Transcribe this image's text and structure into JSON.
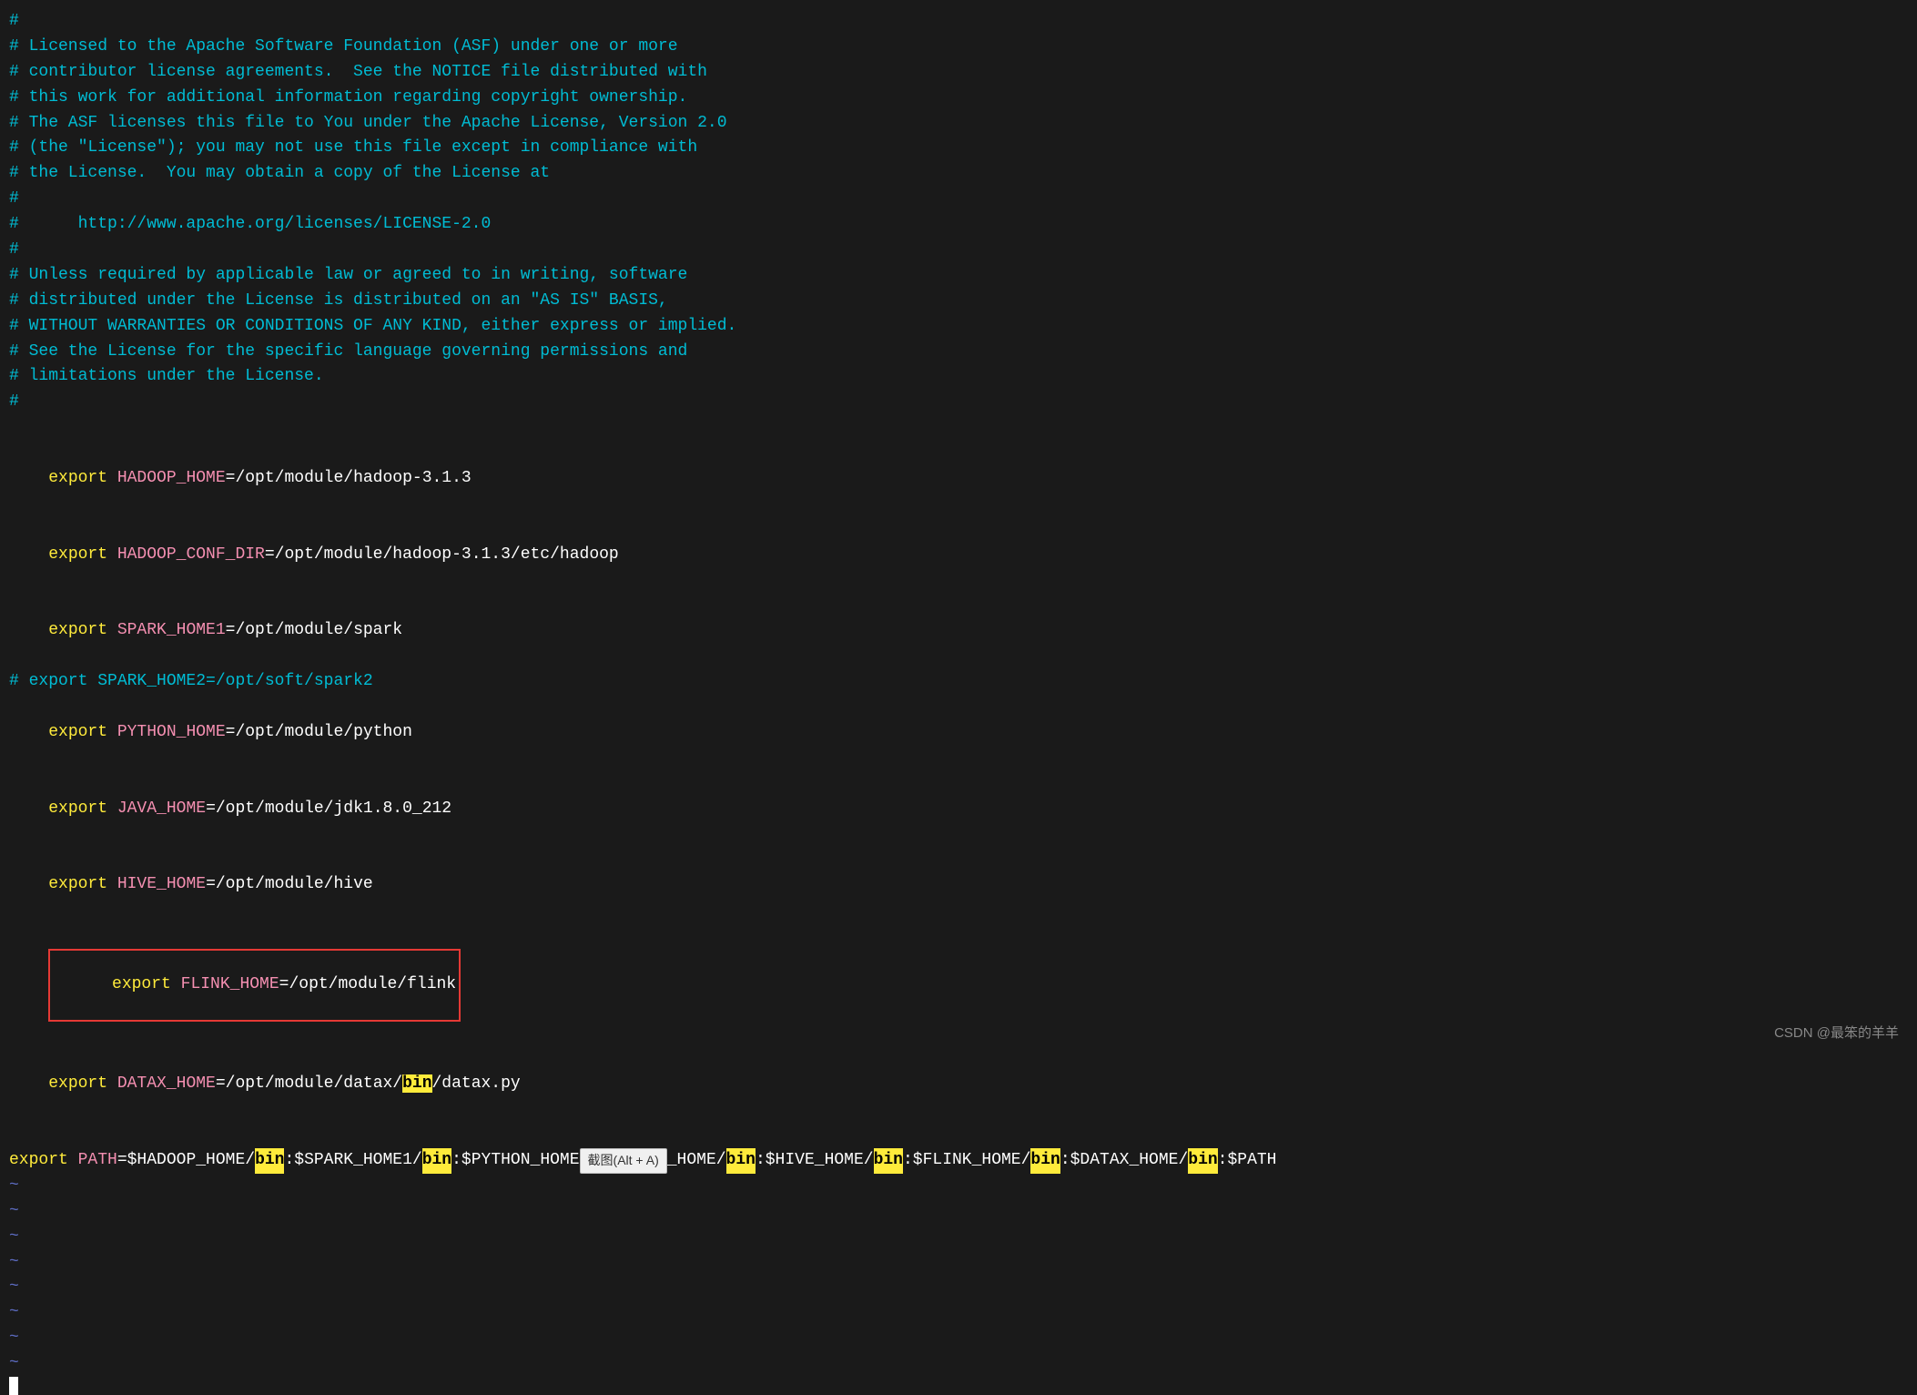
{
  "editor": {
    "background": "#1a1a1a",
    "lines": [
      {
        "type": "comment",
        "text": "#"
      },
      {
        "type": "comment",
        "text": "# Licensed to the Apache Software Foundation (ASF) under one or more"
      },
      {
        "type": "comment",
        "text": "# contributor license agreements.  See the NOTICE file distributed with"
      },
      {
        "type": "comment",
        "text": "# this work for additional information regarding copyright ownership."
      },
      {
        "type": "comment",
        "text": "# The ASF licenses this file to You under the Apache License, Version 2.0"
      },
      {
        "type": "comment",
        "text": "# (the \"License\"); you may not use this file except in compliance with"
      },
      {
        "type": "comment",
        "text": "# the License.  You may obtain a copy of the License at"
      },
      {
        "type": "comment",
        "text": "#"
      },
      {
        "type": "comment",
        "text": "#      http://www.apache.org/licenses/LICENSE-2.0"
      },
      {
        "type": "comment",
        "text": "#"
      },
      {
        "type": "comment",
        "text": "# Unless required by applicable law or agreed to in writing, software"
      },
      {
        "type": "comment",
        "text": "# distributed under the License is distributed on an \"AS IS\" BASIS,"
      },
      {
        "type": "comment",
        "text": "# WITHOUT WARRANTIES OR CONDITIONS OF ANY KIND, either express or implied."
      },
      {
        "type": "comment",
        "text": "# See the License for the specific language governing permissions and"
      },
      {
        "type": "comment",
        "text": "# limitations under the License."
      },
      {
        "type": "comment",
        "text": "#"
      },
      {
        "type": "empty",
        "text": ""
      },
      {
        "type": "export",
        "keyword": "export",
        "varname": "HADOOP_HOME",
        "value": "=/opt/module/hadoop-3.1.3"
      },
      {
        "type": "export",
        "keyword": "export",
        "varname": "HADOOP_CONF_DIR",
        "value": "=/opt/module/hadoop-3.1.3/etc/hadoop"
      },
      {
        "type": "export",
        "keyword": "export",
        "varname": "SPARK_HOME1",
        "value": "=/opt/module/spark"
      },
      {
        "type": "comment",
        "text": "# export SPARK_HOME2=/opt/soft/spark2"
      },
      {
        "type": "export",
        "keyword": "export",
        "varname": "PYTHON_HOME",
        "value": "=/opt/module/python"
      },
      {
        "type": "export",
        "keyword": "export",
        "varname": "JAVA_HOME",
        "value": "=/opt/module/jdk1.8.0_212"
      },
      {
        "type": "export",
        "keyword": "export",
        "varname": "HIVE_HOME",
        "value": "=/opt/module/hive"
      },
      {
        "type": "export_highlighted",
        "keyword": "export",
        "varname": "FLINK_HOME",
        "value": "=/opt/module/flink"
      },
      {
        "type": "export_bin",
        "keyword": "export",
        "varname": "DATAX_HOME",
        "value": "=/opt/module/datax/",
        "bin": "bin",
        "rest": "/datax.py"
      },
      {
        "type": "empty",
        "text": ""
      },
      {
        "type": "path_line"
      },
      {
        "type": "tilde"
      },
      {
        "type": "tilde"
      },
      {
        "type": "tilde"
      },
      {
        "type": "tilde"
      },
      {
        "type": "tilde"
      },
      {
        "type": "tilde"
      },
      {
        "type": "tilde"
      },
      {
        "type": "tilde"
      },
      {
        "type": "cursor_line"
      }
    ],
    "path": {
      "keyword": "export",
      "varname": "PATH",
      "segments": [
        {
          "text": "=$HADOOP_HOME/"
        },
        {
          "text": "bin",
          "highlight": true
        },
        {
          "text": ":$SPARK_HOME1/"
        },
        {
          "text": "bin",
          "highlight": true
        },
        {
          "text": ":$PYTHON_HOME"
        },
        {
          "text": "截图(Alt + A)",
          "tooltip": true
        },
        {
          "text": "_HOME/"
        },
        {
          "text": "bin",
          "highlight": true
        },
        {
          "text": ":$HIVE_HOME/"
        },
        {
          "text": "bin",
          "highlight": true
        },
        {
          "text": ":$FLINK_HOME/"
        },
        {
          "text": "bin",
          "highlight": true
        },
        {
          "text": ":$DATAX_HOME/"
        },
        {
          "text": "bin",
          "highlight": true
        },
        {
          "text": ":$PATH"
        }
      ]
    },
    "tooltip": {
      "text": "截图(Alt + A)"
    }
  },
  "watermark": {
    "text": "CSDN @最笨的羊羊"
  }
}
